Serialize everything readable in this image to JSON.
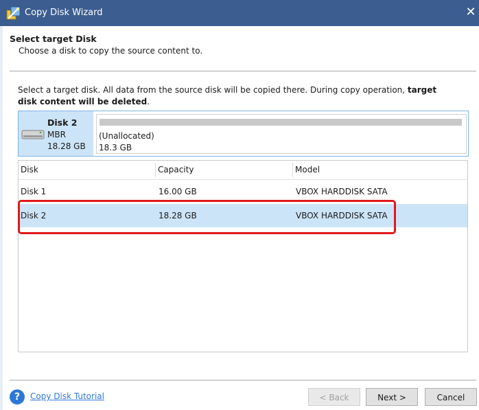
{
  "window": {
    "title": "Copy Disk Wizard",
    "close_glyph": "✕"
  },
  "header": {
    "step_title": "Select target Disk",
    "step_subtitle": "Choose a disk to copy the source content to."
  },
  "description": {
    "text_plain": "Select a target disk. All data from the source disk will be copied there. During copy operation, ",
    "text_bold": "target disk content will be deleted",
    "text_end": "."
  },
  "selected_disk": {
    "name": "Disk 2",
    "type": "MBR",
    "size": "18.28 GB",
    "partition_label": "(Unallocated)",
    "partition_size": "18.3 GB"
  },
  "table": {
    "columns": [
      "Disk",
      "Capacity",
      "Model"
    ],
    "rows": [
      {
        "disk": "Disk 1",
        "capacity": "16.00 GB",
        "model": "VBOX HARDDISK SATA",
        "selected": false
      },
      {
        "disk": "Disk 2",
        "capacity": "18.28 GB",
        "model": "VBOX HARDDISK SATA",
        "selected": true
      }
    ]
  },
  "footer": {
    "help_glyph": "?",
    "tutorial_link": "Copy Disk Tutorial",
    "back_button": "< Back",
    "next_button": "Next >",
    "cancel_button": "Cancel"
  },
  "colors": {
    "titlebar": "#3c5d8f",
    "selection": "#cce4f7",
    "highlight_border": "#e01919",
    "link": "#2d78d6"
  },
  "icons": {
    "app": "wizard-icon",
    "disk": "hard-disk-icon",
    "help": "help-icon",
    "close": "close-icon"
  }
}
